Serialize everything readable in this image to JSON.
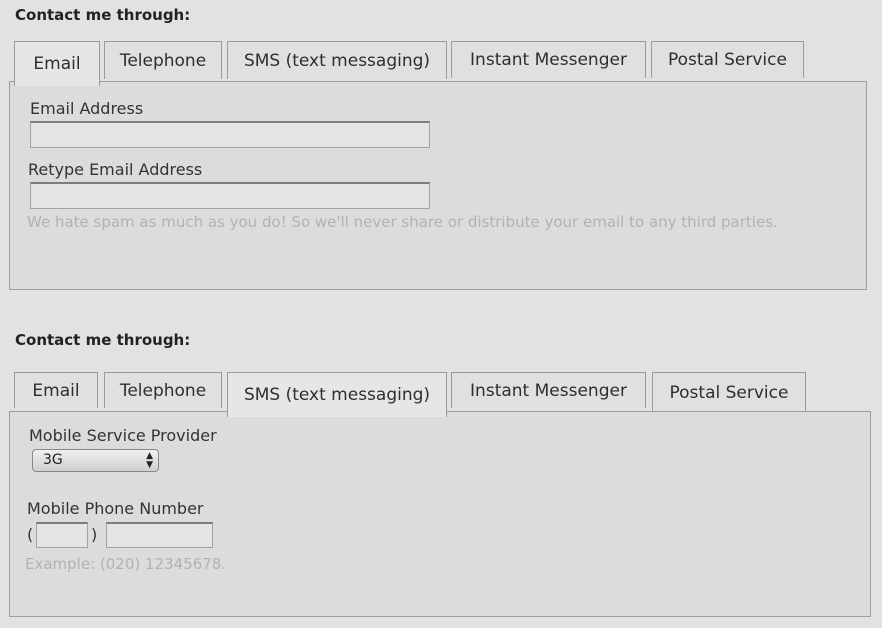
{
  "section1": {
    "heading": "Contact me through:",
    "tabs": [
      {
        "label": "Email",
        "active": true
      },
      {
        "label": "Telephone",
        "active": false
      },
      {
        "label": "SMS (text messaging)",
        "active": false
      },
      {
        "label": "Instant Messenger",
        "active": false
      },
      {
        "label": "Postal Service",
        "active": false
      }
    ],
    "email_label": "Email Address",
    "email_value": "",
    "retype_label": "Retype Email Address",
    "retype_value": "",
    "privacy_note": "We hate spam as much as you do! So we'll never share or distribute your email to any third parties."
  },
  "section2": {
    "heading": "Contact me through:",
    "tabs": [
      {
        "label": "Email",
        "active": false
      },
      {
        "label": "Telephone",
        "active": false
      },
      {
        "label": "SMS (text messaging)",
        "active": true
      },
      {
        "label": "Instant Messenger",
        "active": false
      },
      {
        "label": "Postal Service",
        "active": false
      }
    ],
    "provider_label": "Mobile Service Provider",
    "provider_selected": "3G",
    "phone_label": "Mobile Phone Number",
    "paren_open": "(",
    "paren_close": ")",
    "area_code_value": "",
    "number_value": "",
    "phone_example": "Example: (020) 12345678."
  },
  "icons": {
    "select_arrows": "chevron-up-down-icon"
  }
}
